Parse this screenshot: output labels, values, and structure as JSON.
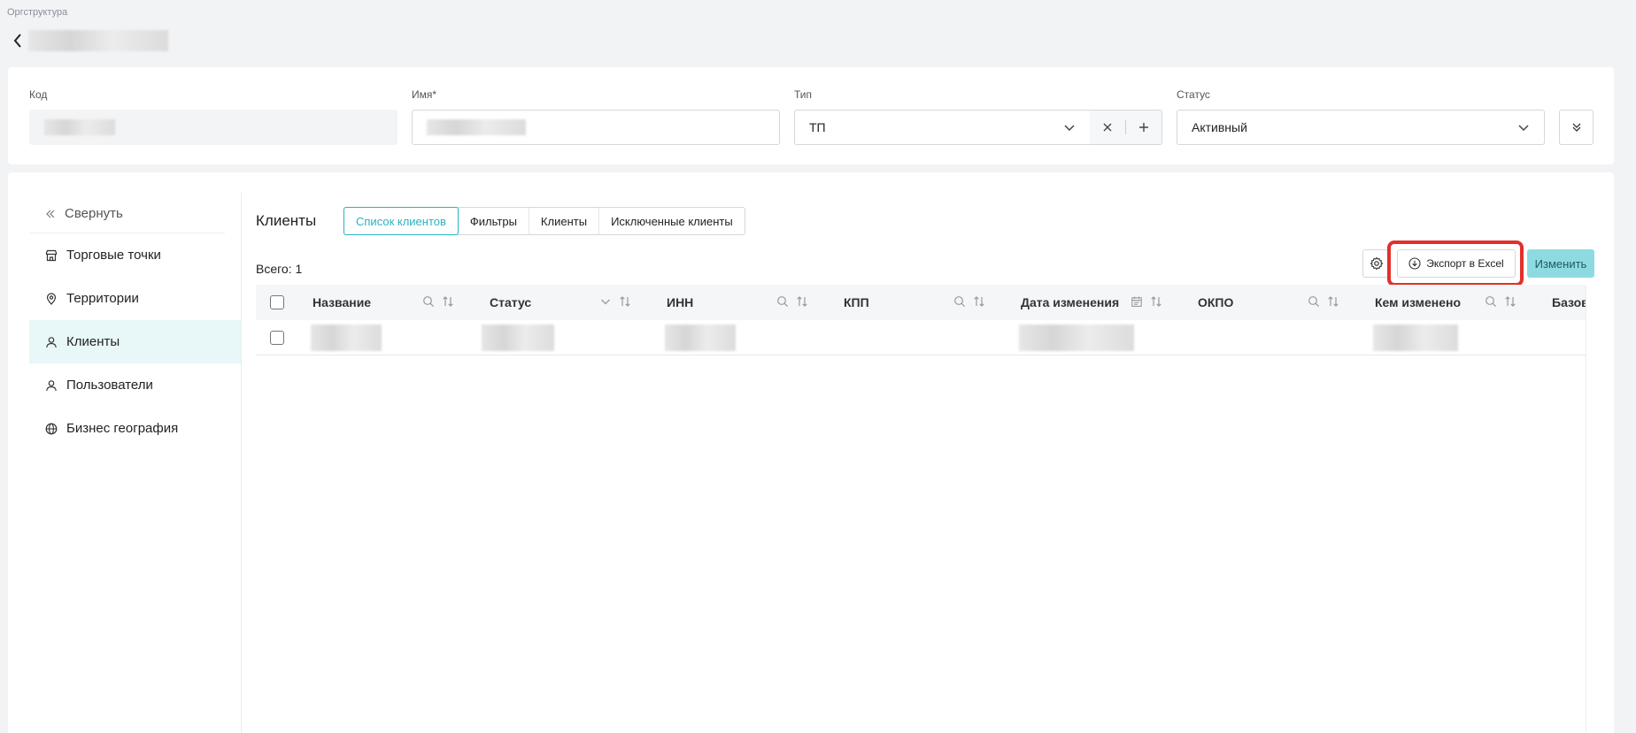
{
  "breadcrumb": "Оргструктура",
  "header": {
    "fields": [
      {
        "label": "Код",
        "value": ""
      },
      {
        "label": "Имя*",
        "value": ""
      },
      {
        "label": "Тип",
        "value": "ТП"
      },
      {
        "label": "Статус",
        "value": "Активный"
      }
    ]
  },
  "sidebar": {
    "collapse_label": "Свернуть",
    "items": [
      {
        "label": "Торговые точки",
        "icon": "store-icon",
        "active": false
      },
      {
        "label": "Территории",
        "icon": "location-pin-icon",
        "active": false
      },
      {
        "label": "Клиенты",
        "icon": "user-icon",
        "active": true
      },
      {
        "label": "Пользователи",
        "icon": "user-icon",
        "active": false
      },
      {
        "label": "Бизнес география",
        "icon": "globe-icon",
        "active": false
      }
    ]
  },
  "section": {
    "title": "Клиенты",
    "tabs": [
      "Список клиентов",
      "Фильтры",
      "Клиенты",
      "Исключенные клиенты"
    ],
    "active_tab": 0,
    "total_label": "Всего: 1",
    "export_label": "Экспорт в Excel",
    "edit_label": "Изменить"
  },
  "table": {
    "columns": [
      "Название",
      "Статус",
      "ИНН",
      "КПП",
      "Дата изменения",
      "ОКПО",
      "Кем изменено",
      "Базов"
    ],
    "rows_count": 1
  },
  "colors": {
    "accent": "#2ab3c0",
    "accent_light": "#8ddbe1",
    "highlight": "#e0312c",
    "active_bg": "#e8f7f8"
  }
}
